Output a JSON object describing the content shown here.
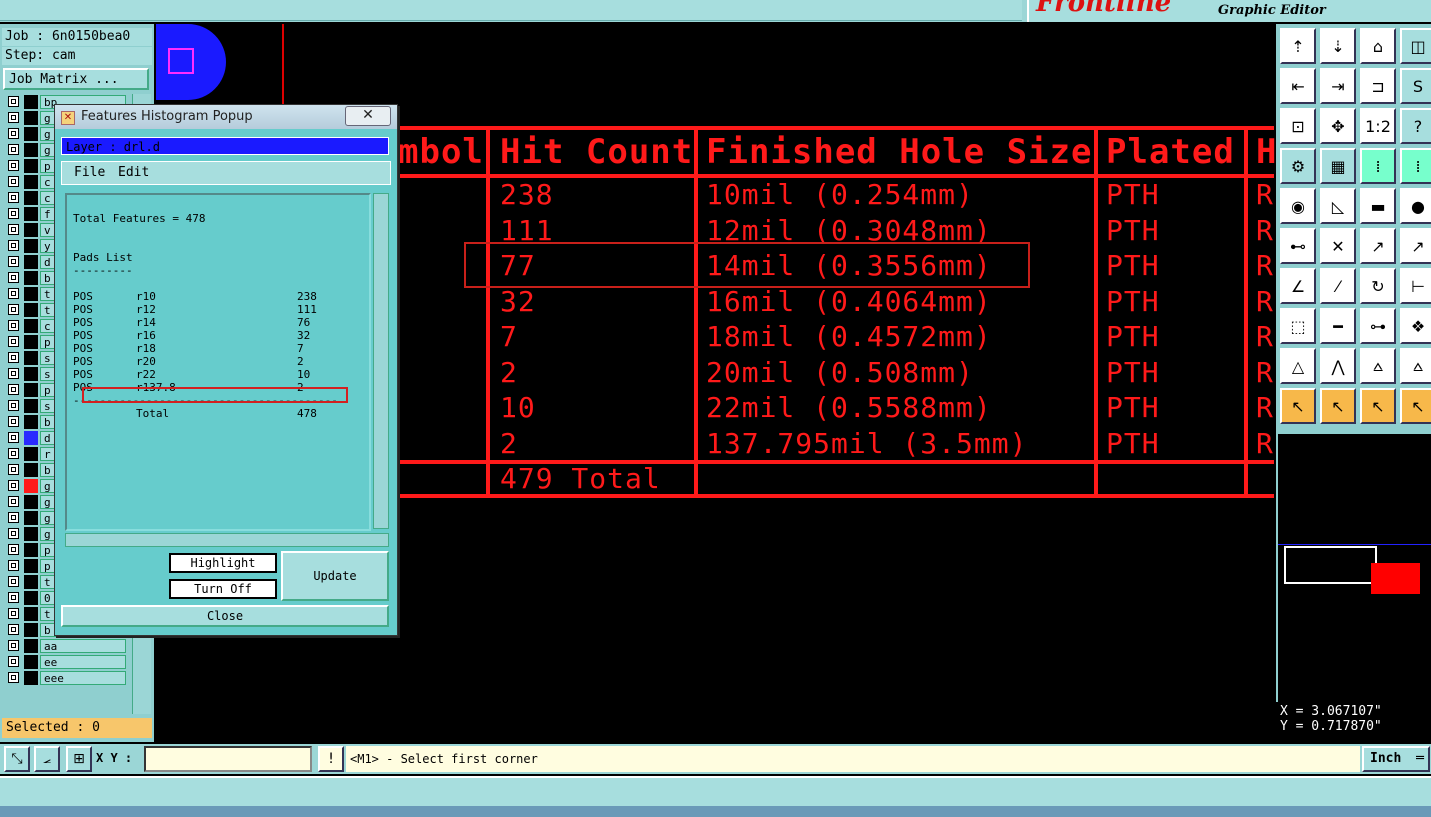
{
  "app": {
    "brand": "Frontline",
    "subtitle": "Graphic Editor"
  },
  "left_panel": {
    "job": "Job : 6n0150bea0",
    "step": "Step: cam",
    "job_matrix": "Job Matrix ...",
    "layers": [
      {
        "name": "bp",
        "swatch": "#000"
      },
      {
        "name": "g",
        "swatch": "#000"
      },
      {
        "name": "g",
        "swatch": "#000"
      },
      {
        "name": "g",
        "swatch": "#000"
      },
      {
        "name": "p",
        "swatch": "#000"
      },
      {
        "name": "c",
        "swatch": "#000"
      },
      {
        "name": "c",
        "swatch": "#000"
      },
      {
        "name": "f",
        "swatch": "#000"
      },
      {
        "name": "v",
        "swatch": "#000"
      },
      {
        "name": "y",
        "swatch": "#000"
      },
      {
        "name": "d",
        "swatch": "#000"
      },
      {
        "name": "b",
        "swatch": "#000"
      },
      {
        "name": "t",
        "swatch": "#000"
      },
      {
        "name": "t",
        "swatch": "#000"
      },
      {
        "name": "c",
        "swatch": "#000"
      },
      {
        "name": "p",
        "swatch": "#000"
      },
      {
        "name": "s",
        "swatch": "#000"
      },
      {
        "name": "s",
        "swatch": "#000"
      },
      {
        "name": "p",
        "swatch": "#000"
      },
      {
        "name": "s",
        "swatch": "#000"
      },
      {
        "name": "b",
        "swatch": "#000"
      },
      {
        "name": "d",
        "swatch": "#2a2aff"
      },
      {
        "name": "r",
        "swatch": "#000"
      },
      {
        "name": "b",
        "swatch": "#000"
      },
      {
        "name": "g",
        "swatch": "#ff1a1a"
      },
      {
        "name": "g",
        "swatch": "#000"
      },
      {
        "name": "g",
        "swatch": "#000"
      },
      {
        "name": "g",
        "swatch": "#000"
      },
      {
        "name": "p",
        "swatch": "#000"
      },
      {
        "name": "p",
        "swatch": "#000"
      },
      {
        "name": "t",
        "swatch": "#000"
      },
      {
        "name": "0",
        "swatch": "#000"
      },
      {
        "name": "t",
        "swatch": "#000"
      },
      {
        "name": "b",
        "swatch": "#000"
      },
      {
        "name": "aa",
        "swatch": "#000"
      },
      {
        "name": "ee",
        "swatch": "#000"
      },
      {
        "name": "eee",
        "swatch": "#000"
      }
    ],
    "selected": "Selected : 0"
  },
  "table": {
    "headers": [
      "mbol",
      "Hit Count",
      "Finished Hole Size",
      "Plated",
      "H"
    ],
    "rows": [
      {
        "count": "238",
        "size": "10mil (0.254mm)",
        "plated": "PTH",
        "h": "R"
      },
      {
        "count": "111",
        "size": "12mil (0.3048mm)",
        "plated": "PTH",
        "h": "R"
      },
      {
        "count": "77",
        "size": "14mil (0.3556mm)",
        "plated": "PTH",
        "h": "R"
      },
      {
        "count": "32",
        "size": "16mil (0.4064mm)",
        "plated": "PTH",
        "h": "R"
      },
      {
        "count": "7",
        "size": "18mil (0.4572mm)",
        "plated": "PTH",
        "h": "R"
      },
      {
        "count": "2",
        "size": "20mil (0.508mm)",
        "plated": "PTH",
        "h": "R"
      },
      {
        "count": "10",
        "size": "22mil (0.5588mm)",
        "plated": "PTH",
        "h": "R"
      },
      {
        "count": "2",
        "size": "137.795mil (3.5mm)",
        "plated": "PTH",
        "h": "R"
      }
    ],
    "total": "479 Total"
  },
  "popup": {
    "title": "Features Histogram Popup",
    "close_x": "✕",
    "layer": "Layer :  drl.d",
    "menu": {
      "file": "File",
      "edit": "Edit"
    },
    "total_features": "Total Features = 478",
    "pads_list": "Pads List",
    "pads_underline": "---------",
    "pads": [
      {
        "type": "POS",
        "sym": "r10",
        "count": "238"
      },
      {
        "type": "POS",
        "sym": "r12",
        "count": "111"
      },
      {
        "type": "POS",
        "sym": "r14",
        "count": "76"
      },
      {
        "type": "POS",
        "sym": "r16",
        "count": "32"
      },
      {
        "type": "POS",
        "sym": "r18",
        "count": "7"
      },
      {
        "type": "POS",
        "sym": "r20",
        "count": "2"
      },
      {
        "type": "POS",
        "sym": "r22",
        "count": "10"
      },
      {
        "type": "POS",
        "sym": "r137.8",
        "count": "2"
      }
    ],
    "separator": "----------------------------------------",
    "total_label": "Total",
    "total_value": "478",
    "highlight": "Highlight",
    "turn_off": "Turn Off",
    "update": "Update",
    "close": "Close"
  },
  "coords": {
    "x": "X = 3.067107\"",
    "y": "Y = 0.717870\""
  },
  "bottom": {
    "xy_label": "X Y :",
    "bang": "!",
    "status": "<M1> - Select first corner",
    "unit": "Inch"
  },
  "colors": {
    "drill_red": "#ff1a1a",
    "panel_teal": "#8fcfcf",
    "highlight_orange": "#f7b84a"
  }
}
